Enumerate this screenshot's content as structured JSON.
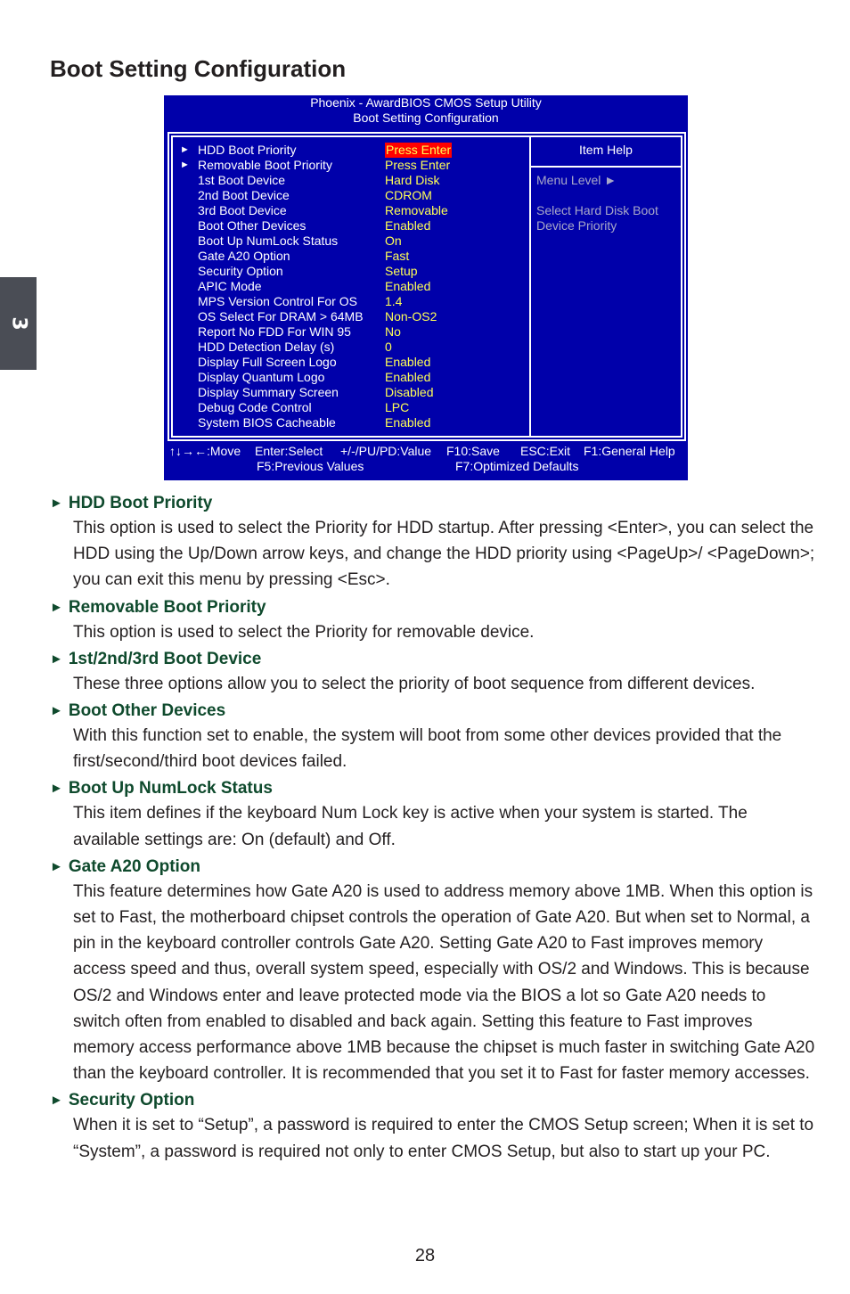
{
  "page": {
    "title": "Boot Setting Configuration",
    "chapter": "3",
    "page_number": "28"
  },
  "bios": {
    "header_line1": "Phoenix - AwardBIOS CMOS Setup Utility",
    "header_line2": "Boot Setting Configuration",
    "colors": {
      "background": "#0000aa",
      "value": "#ffff55",
      "selected_bg": "#ff0000",
      "help_text": "#a8a8c8"
    },
    "items": [
      {
        "submenu": true,
        "label": "HDD Boot Priority",
        "value": "Press Enter",
        "selected": true
      },
      {
        "submenu": true,
        "label": "Removable Boot Priority",
        "value": "Press Enter"
      },
      {
        "submenu": false,
        "label": "1st Boot Device",
        "value": "Hard Disk"
      },
      {
        "submenu": false,
        "label": "2nd Boot Device",
        "value": "CDROM"
      },
      {
        "submenu": false,
        "label": "3rd Boot Device",
        "value": "Removable"
      },
      {
        "submenu": false,
        "label": "Boot Other Devices",
        "value": "Enabled"
      },
      {
        "submenu": false,
        "label": "Boot Up NumLock Status",
        "value": "On"
      },
      {
        "submenu": false,
        "label": "Gate A20 Option",
        "value": "Fast"
      },
      {
        "submenu": false,
        "label": "Security Option",
        "value": "Setup"
      },
      {
        "submenu": false,
        "label": "APIC Mode",
        "value": "Enabled"
      },
      {
        "submenu": false,
        "label": "MPS Version Control For OS",
        "value": "1.4"
      },
      {
        "submenu": false,
        "label": "OS Select For DRAM > 64MB",
        "value": "Non-OS2"
      },
      {
        "submenu": false,
        "label": "Report No FDD For WIN 95",
        "value": "No"
      },
      {
        "submenu": false,
        "label": "HDD Detection Delay (s)",
        "value": "0"
      },
      {
        "submenu": false,
        "label": "Display Full Screen Logo",
        "value": "Enabled"
      },
      {
        "submenu": false,
        "label": "Display Quantum Logo",
        "value": "Enabled"
      },
      {
        "submenu": false,
        "label": "Display Summary Screen",
        "value": "Disabled"
      },
      {
        "submenu": false,
        "label": "Debug Code Control",
        "value": "LPC"
      },
      {
        "submenu": false,
        "label": "System BIOS Cacheable",
        "value": "Enabled"
      }
    ],
    "submenu_arrow": "►",
    "help": {
      "title": "Item Help",
      "menu_level": "Menu Level  ►",
      "text_line1": "Select Hard Disk Boot",
      "text_line2": "Device Priority"
    },
    "footer": {
      "move": "↑↓→←:Move",
      "select": "Enter:Select",
      "value": "+/-/PU/PD:Value",
      "save": "F10:Save",
      "exit": "ESC:Exit",
      "help": "F1:General Help",
      "previous": "F5:Previous Values",
      "defaults": "F7:Optimized Defaults"
    }
  },
  "sections": [
    {
      "heading": "HDD Boot Priority",
      "body": "This option is used to select the Priority for HDD startup. After pressing <Enter>, you can select the HDD using the Up/Down arrow keys, and change the HDD priority using <PageUp>/ <PageDown>; you can exit this menu by pressing <Esc>."
    },
    {
      "heading": "Removable Boot Priority",
      "body": "This option is used to select the Priority for removable device."
    },
    {
      "heading": "1st/2nd/3rd Boot Device",
      "body": "These three options allow you to select the priority of boot sequence from different devices."
    },
    {
      "heading": "Boot Other Devices",
      "body": "With this function set to enable, the system will boot from some other devices provided that the first/second/third boot devices failed."
    },
    {
      "heading": "Boot Up NumLock Status",
      "body": "This item defines if the keyboard Num Lock key is active when your system is started. The available settings are: On (default) and Off."
    },
    {
      "heading": "Gate A20 Option",
      "body": "This feature determines how Gate A20 is used to address memory above 1MB. When this option is set to Fast, the motherboard chipset controls the operation of Gate A20. But when set to Normal, a pin in the keyboard controller controls Gate A20. Setting Gate A20 to Fast improves memory access speed and thus, overall system speed, especially with OS/2 and Windows. This is because OS/2 and Windows enter and leave protected mode via the BIOS a lot so Gate A20 needs to switch often from enabled to disabled and back again. Setting this feature to Fast improves memory access performance above 1MB because the chipset is much faster in switching Gate A20 than the keyboard controller. It is recommended that you set it to Fast for faster memory accesses."
    },
    {
      "heading": "Security Option",
      "body": "When it is set to “Setup”, a password is required to enter the CMOS Setup screen; When it is set to “System”, a password is required not only to enter CMOS Setup, but also to start up your PC."
    }
  ],
  "section_marker": "►"
}
